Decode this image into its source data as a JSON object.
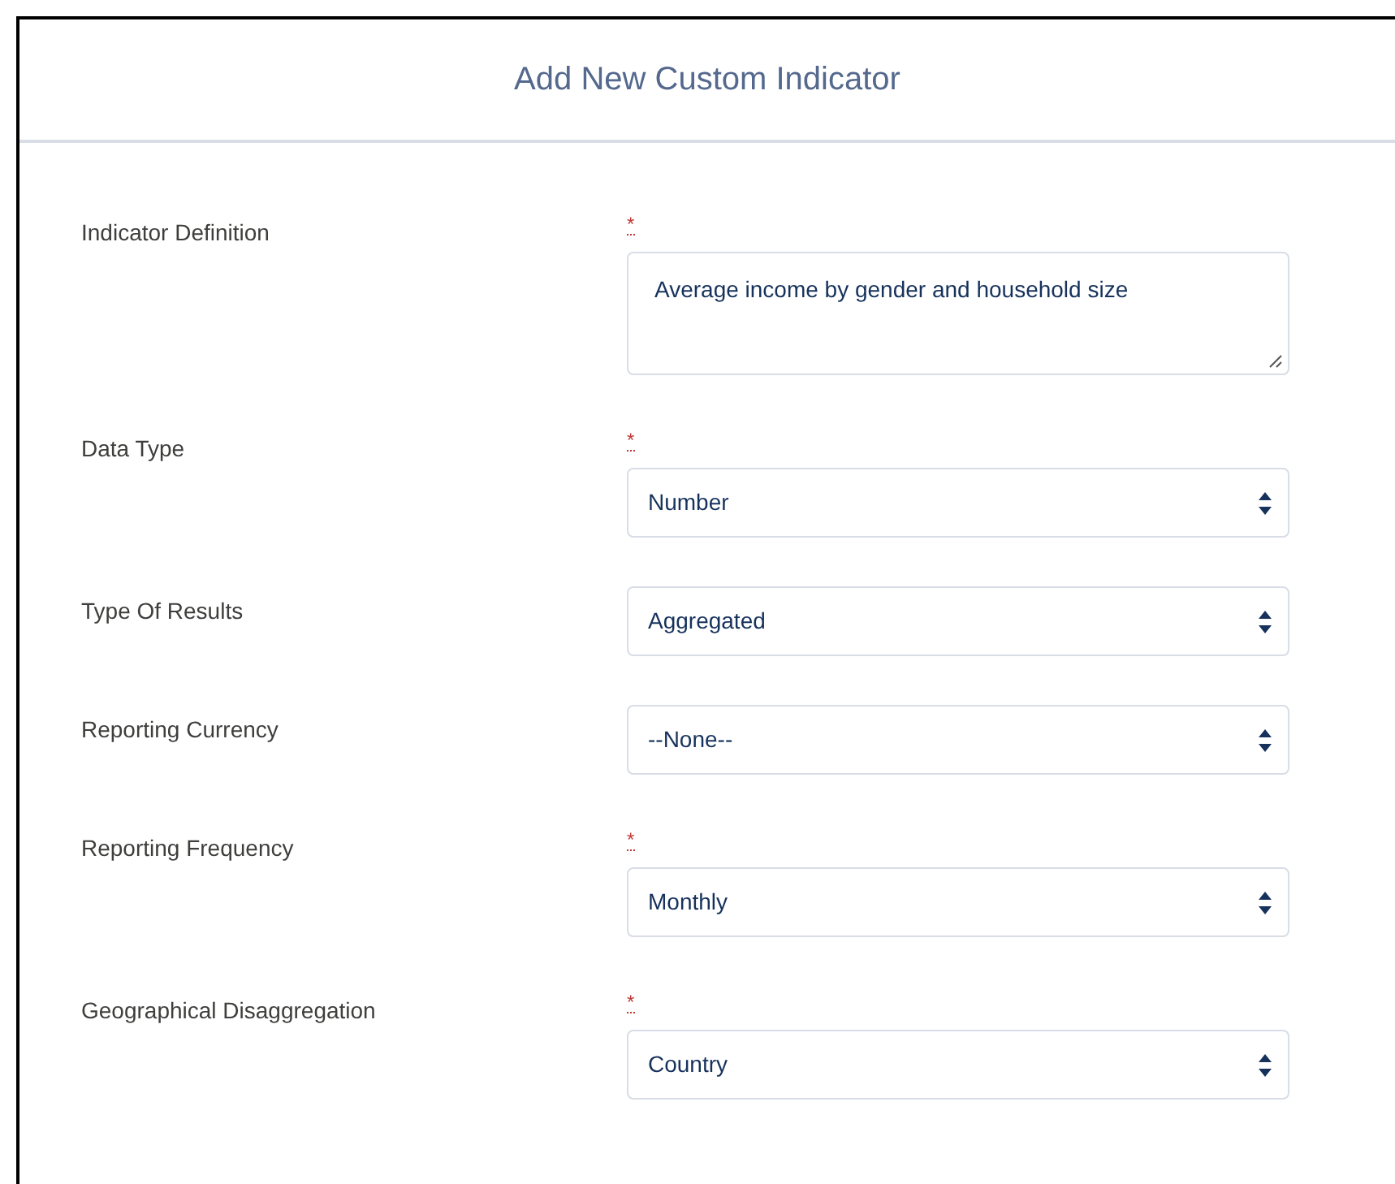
{
  "dialog": {
    "title": "Add New Custom Indicator"
  },
  "required_marker": "*",
  "fields": [
    {
      "label": "Indicator Definition",
      "kind": "textarea",
      "required": true,
      "value": "Average income by gender and household size"
    },
    {
      "label": "Data Type",
      "kind": "select",
      "required": true,
      "value": "Number"
    },
    {
      "label": "Type Of Results",
      "kind": "select",
      "required": false,
      "value": "Aggregated"
    },
    {
      "label": "Reporting Currency",
      "kind": "select",
      "required": false,
      "value": "--None--"
    },
    {
      "label": "Reporting Frequency",
      "kind": "select",
      "required": true,
      "value": "Monthly"
    },
    {
      "label": "Geographical Disaggregation",
      "kind": "select",
      "required": true,
      "value": "Country"
    }
  ]
}
